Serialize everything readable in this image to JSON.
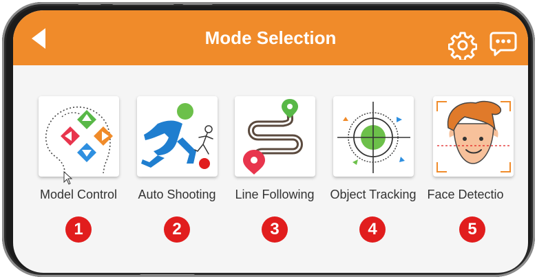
{
  "header": {
    "title": "Mode Selection",
    "back_icon": "back-arrow-icon",
    "settings_icon": "gear-icon",
    "message_icon": "chat-bubble-icon"
  },
  "colors": {
    "accent": "#f08b2a",
    "badge": "#e11d1d",
    "screen_bg": "#f5f5f5"
  },
  "modes": [
    {
      "label": "Model Control",
      "number": "1",
      "icon": "head-dpad-icon"
    },
    {
      "label": "Auto Shooting",
      "number": "2",
      "icon": "kicking-player-icon"
    },
    {
      "label": "Line Following",
      "number": "3",
      "icon": "winding-path-icon"
    },
    {
      "label": "Object Tracking",
      "number": "4",
      "icon": "crosshair-target-icon"
    },
    {
      "label": "Face Detectio",
      "number": "5",
      "icon": "face-scan-icon"
    }
  ]
}
